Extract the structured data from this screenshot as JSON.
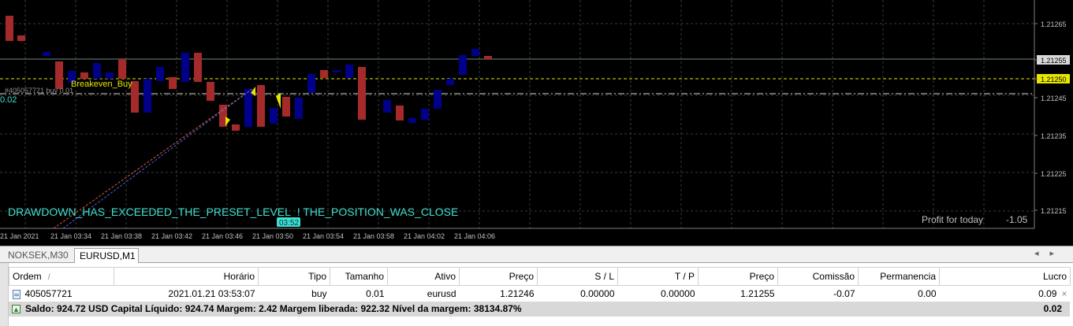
{
  "chart": {
    "price_labels": [
      "1.21265",
      "1.21255",
      "1.21250",
      "1.21245",
      "1.21235",
      "1.21225",
      "1.21215"
    ],
    "time_labels": [
      "21 Jan 2021",
      "21 Jan 03:34",
      "21 Jan 03:38",
      "21 Jan 03:42",
      "21 Jan 03:46",
      "21 Jan 03:50",
      "21 Jan 03:54",
      "21 Jan 03:58",
      "21 Jan 04:02",
      "21 Jan 04:06"
    ],
    "breakeven_label": "Breakeven_Buy",
    "order_line_label": "#405057721 buy 0.01",
    "order_profit_label": "0.02",
    "drawdown_message": "DRAWDOWN_HAS_EXCEEDED_THE_PRESET_LEVEL_! THE_POSITION_WAS_CLOSE",
    "time_marker": "03:52",
    "profit_label": "Profit for today",
    "profit_value": "-1.05",
    "colors": {
      "background": "#000000",
      "bull": "#00008b",
      "bear": "#a52a2a",
      "grid": "#3a3a3a",
      "breakeven_line": "#e6e600",
      "message": "#40e0d0"
    }
  },
  "tabs": [
    {
      "label": "NOKSEK,M30",
      "active": false
    },
    {
      "label": "EURUSD,M1",
      "active": true
    }
  ],
  "orders": {
    "columns": [
      "Ordem",
      "Horário",
      "Tipo",
      "Tamanho",
      "Ativo",
      "Preço",
      "S / L",
      "T / P",
      "Preço",
      "Comissão",
      "Permanencia",
      "Lucro"
    ],
    "sort_indicator": "/",
    "rows": [
      {
        "order": "405057721",
        "time": "2021.01.21 03:53:07",
        "type": "buy",
        "size": "0.01",
        "symbol": "eurusd",
        "open_price": "1.21246",
        "sl": "0.00000",
        "tp": "0.00000",
        "price": "1.21255",
        "commission": "-0.07",
        "swap": "0.00",
        "profit": "0.09"
      }
    ],
    "summary": "Saldo: 924.72 USD  Capital Líquido: 924.74  Margem: 2.42  Margem liberada: 922.32  Nível da margem: 38134.87%",
    "summary_total": "0.02"
  }
}
